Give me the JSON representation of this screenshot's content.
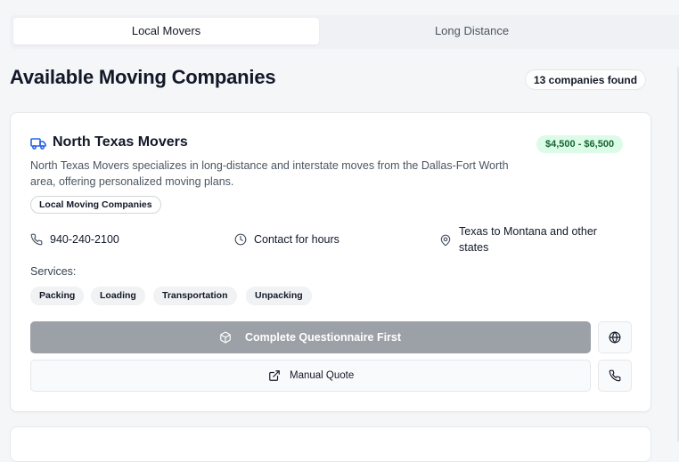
{
  "tabs": {
    "local": "Local Movers",
    "long_distance": "Long Distance"
  },
  "header": {
    "title": "Available Moving Companies",
    "count": "13 companies found"
  },
  "company": {
    "name": "North Texas Movers",
    "price": "$4,500 - $6,500",
    "description": "North Texas Movers specializes in long-distance and interstate moves from the Dallas-Fort Worth area, offering personalized moving plans.",
    "category": "Local Moving Companies",
    "phone": "940-240-2100",
    "hours": "Contact for hours",
    "service_area": "Texas to Montana and other states",
    "services_label": "Services:",
    "services": [
      "Packing",
      "Loading",
      "Transportation",
      "Unpacking"
    ],
    "primary_button": "Complete Questionnaire First",
    "quote_button": "Manual Quote"
  },
  "icons": {
    "truck": "truck-icon",
    "phone": "phone-icon",
    "clock": "clock-icon",
    "location": "map-pin-icon",
    "package": "package-icon",
    "external": "external-link-icon",
    "globe": "globe-icon"
  },
  "colors": {
    "accent": "#2563eb",
    "price_bg": "#dcfce7",
    "price_text": "#166534",
    "disabled_button": "#9ca0a7"
  }
}
